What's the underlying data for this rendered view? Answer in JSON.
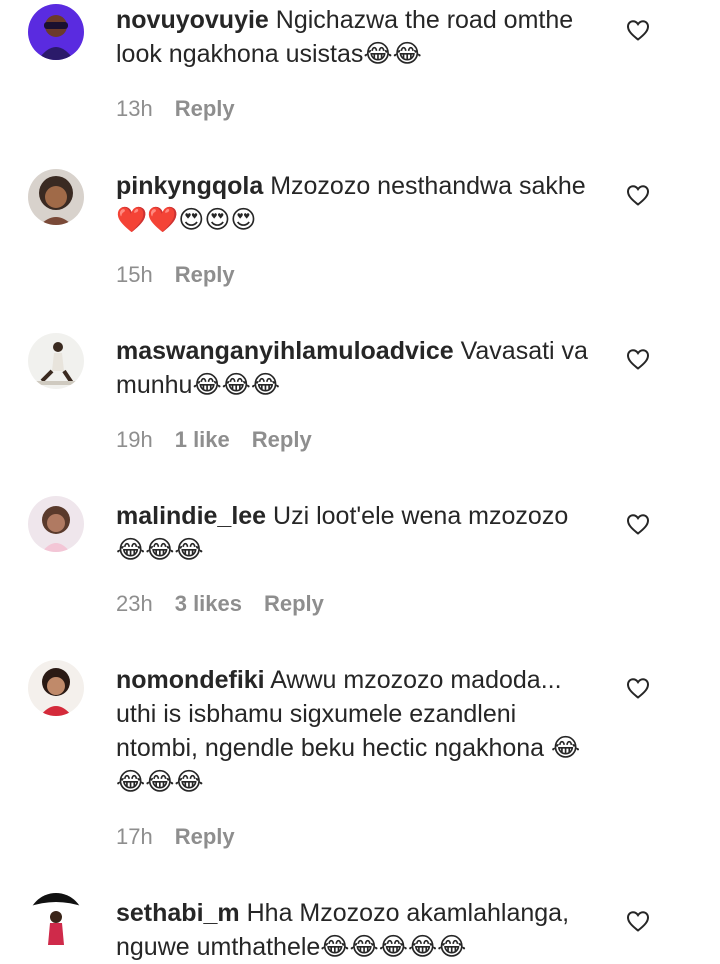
{
  "comments": [
    {
      "username": "novuyovuyie",
      "text": "Ngichazwa the road omthe look ngakhona usistas😂😂",
      "time": "13h",
      "likes": "",
      "reply": "Reply"
    },
    {
      "username": "pinkyngqola",
      "text": "Mzozozo nesthandwa sakhe ❤️❤️😍😍😍",
      "time": "15h",
      "likes": "",
      "reply": "Reply"
    },
    {
      "username": "maswanganyihlamuloadvice",
      "text": "Vavasati va munhu😂😂😂",
      "time": "19h",
      "likes": "1 like",
      "reply": "Reply"
    },
    {
      "username": "malindie_lee",
      "text": "Uzi loot'ele wena mzozozo 😂😂😂",
      "time": "23h",
      "likes": "3 likes",
      "reply": "Reply"
    },
    {
      "username": "nomondefiki",
      "text": "Awwu mzozozo madoda... uthi is isbhamu sigxumele ezandleni ntombi, ngendle beku hectic ngakhona 😂😂😂😂",
      "time": "17h",
      "likes": "",
      "reply": "Reply"
    },
    {
      "username": "sethabi_m",
      "text": "Hha Mzozozo akamlahlanga, nguwe umthathele😂😂😂😂😂",
      "time": "",
      "likes": "",
      "reply": ""
    }
  ],
  "icons": {
    "like": "heart-outline-icon"
  },
  "colors": {
    "text": "#262626",
    "meta": "#8e8e8e"
  }
}
